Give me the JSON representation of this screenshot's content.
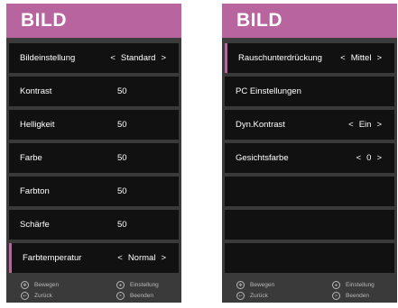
{
  "left_panel": {
    "title": "BILD",
    "items": [
      {
        "label": "Bildeinstellung",
        "value": "Standard",
        "arrows": true,
        "selected": false
      },
      {
        "label": "Kontrast",
        "value": "50",
        "arrows": false,
        "selected": false
      },
      {
        "label": "Helligkeit",
        "value": "50",
        "arrows": false,
        "selected": false
      },
      {
        "label": "Farbe",
        "value": "50",
        "arrows": false,
        "selected": false
      },
      {
        "label": "Farbton",
        "value": "50",
        "arrows": false,
        "selected": false
      },
      {
        "label": "Schärfe",
        "value": "50",
        "arrows": false,
        "selected": false
      },
      {
        "label": "Farbtemperatur",
        "value": "Normal",
        "arrows": true,
        "selected": true
      }
    ],
    "footer": {
      "move_label": "Bewegen",
      "move_icon": "dpad-icon",
      "back_label": "Zurück",
      "back_icon": "back-icon",
      "settings_label": "Einstellung",
      "settings_icon": "ok-icon",
      "exit_label": "Beenden",
      "exit_icon": "exit-icon"
    }
  },
  "right_panel": {
    "title": "BILD",
    "items": [
      {
        "label": "Rauschunterdrückung",
        "value": "Mittel",
        "arrows": true,
        "selected": true
      },
      {
        "label": "PC Einstellungen",
        "value": "",
        "arrows": false,
        "selected": false
      },
      {
        "label": "Dyn.Kontrast",
        "value": "Ein",
        "arrows": true,
        "selected": false
      },
      {
        "label": "Gesichtsfarbe",
        "value": "0",
        "arrows": true,
        "selected": false
      },
      {
        "label": "",
        "value": "",
        "arrows": false,
        "selected": false
      },
      {
        "label": "",
        "value": "",
        "arrows": false,
        "selected": false
      },
      {
        "label": "",
        "value": "",
        "arrows": false,
        "selected": false
      }
    ],
    "footer": {
      "move_label": "Bewegen",
      "move_icon": "dpad-icon",
      "back_label": "Zurück",
      "back_icon": "back-icon",
      "settings_label": "Einstellung",
      "settings_icon": "ok-icon",
      "exit_label": "Beenden",
      "exit_icon": "exit-icon"
    }
  },
  "arrows": {
    "left": "<",
    "right": ">"
  },
  "colors": {
    "header": "#b7649f",
    "row": "#111111",
    "panel": "#3a3a3a",
    "text": "#ffffff",
    "footer_text": "#b8b8b8"
  }
}
